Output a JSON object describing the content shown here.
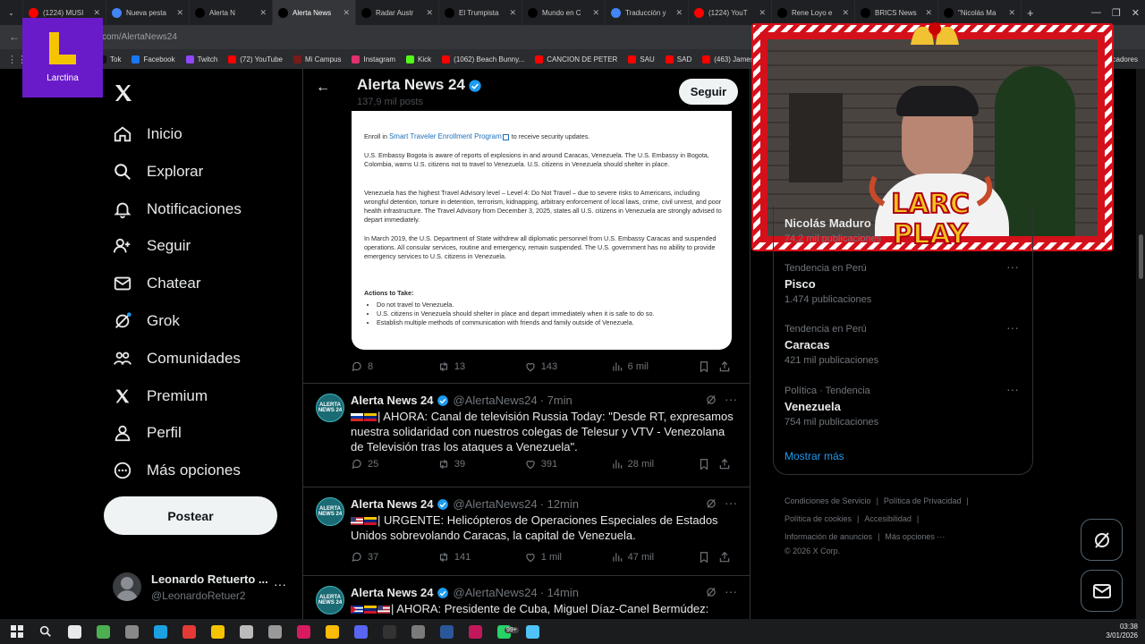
{
  "browser": {
    "tabs": [
      {
        "label": "(1224) MUSI",
        "color": "#ff0000"
      },
      {
        "label": "Nueva pesta",
        "color": "#4285f4"
      },
      {
        "label": "Alerta N",
        "color": "#000000"
      },
      {
        "label": "Alerta News",
        "color": "#000000",
        "active": true
      },
      {
        "label": "Radar Austr",
        "color": "#000000"
      },
      {
        "label": "El Trumpista",
        "color": "#000000"
      },
      {
        "label": "Mundo en C",
        "color": "#000000"
      },
      {
        "label": "Traducción y",
        "color": "#4285f4"
      },
      {
        "label": "(1224) YouT",
        "color": "#ff0000"
      },
      {
        "label": "Rene Loyo e",
        "color": "#000000"
      },
      {
        "label": "BRICS News",
        "color": "#000000"
      },
      {
        "label": "\"Nicolás Ma",
        "color": "#000000"
      }
    ],
    "new_tab": "+",
    "url": "com/AlertaNews24",
    "bookmarks": [
      {
        "label": "Tok",
        "color": "#111111"
      },
      {
        "label": "Facebook",
        "color": "#1877f2"
      },
      {
        "label": "Twitch",
        "color": "#9146ff"
      },
      {
        "label": "(72) YouTube",
        "color": "#ff0000"
      },
      {
        "label": "Mi Campus",
        "color": "#7b1a1a"
      },
      {
        "label": "Instagram",
        "color": "#e1306c"
      },
      {
        "label": "Kick",
        "color": "#53fc18"
      },
      {
        "label": "(1062) Beach Bunny...",
        "color": "#ff0000"
      },
      {
        "label": "CANCION DE PETER",
        "color": "#ff0000"
      },
      {
        "label": "SAU",
        "color": "#ff0000"
      },
      {
        "label": "SAD",
        "color": "#ff0000"
      },
      {
        "label": "(463) James Arth",
        "color": "#ff0000"
      }
    ],
    "bookmarks_end": "cadores"
  },
  "overlay": {
    "logo_label": "Larctina",
    "logo_letter": "L",
    "webcam_brand_line1": "LARC",
    "webcam_brand_line2": "PLAY"
  },
  "nav": {
    "items": [
      {
        "label": "Inicio",
        "icon": "home-icon"
      },
      {
        "label": "Explorar",
        "icon": "search-icon"
      },
      {
        "label": "Notificaciones",
        "icon": "bell-icon"
      },
      {
        "label": "Seguir",
        "icon": "follow-icon"
      },
      {
        "label": "Chatear",
        "icon": "mail-icon"
      },
      {
        "label": "Grok",
        "icon": "grok-icon"
      },
      {
        "label": "Comunidades",
        "icon": "communities-icon"
      },
      {
        "label": "Premium",
        "icon": "x-icon"
      },
      {
        "label": "Perfil",
        "icon": "person-icon"
      },
      {
        "label": "Más opciones",
        "icon": "more-icon"
      }
    ],
    "post_button": "Postear",
    "account_name": "Leonardo Retuerto ...",
    "account_handle": "@LeonardoRetuer2"
  },
  "header": {
    "title": "Alerta News 24",
    "posts_count": "137,9 mil posts",
    "follow_button": "Seguir"
  },
  "embedded_doc": {
    "enroll_pre": "Enroll in ",
    "enroll_link": "Smart Traveler Enrollment Program",
    "enroll_post": " to receive security updates.",
    "p1": "U.S. Embassy Bogota is aware of reports of explosions in and around Caracas, Venezuela. The U.S. Embassy in Bogota, Colombia, warns U.S. citizens not to travel to Venezuela.  U.S. citizens in Venezuela should shelter in place.",
    "p2": "Venezuela has the highest Travel Advisory level – Level 4: Do Not Travel – due to severe risks to Americans, including wrongful detention, torture in detention, terrorism, kidnapping, arbitrary enforcement of local laws, crime, civil unrest, and poor health infrastructure.  The Travel Advisory from December 3, 2025, states all U.S. citizens in Venezuela are strongly advised to depart immediately.",
    "p3": "In March 2019, the U.S. Department of State withdrew all diplomatic personnel from U.S. Embassy Caracas and suspended operations.  All consular services, routine and emergency, remain suspended.  The U.S. government has no ability to provide emergency services to U.S. citizens in Venezuela.",
    "actions_title": "Actions to Take:",
    "actions": [
      "Do not travel to Venezuela.",
      "U.S. citizens in Venezuela should shelter in place and depart immediately when it is safe to do so.",
      "Establish multiple methods of communication with friends and family outside of Venezuela."
    ],
    "stats": {
      "replies": "8",
      "reposts": "13",
      "likes": "143",
      "views": "6 mil"
    }
  },
  "tweets": [
    {
      "name": "Alerta News 24",
      "handle": "@AlertaNews24",
      "time": "· 7min",
      "flags": [
        "ru",
        "ve"
      ],
      "text": "| AHORA: Canal de televisión Russia Today: \"Desde RT, expresamos nuestra solidaridad con nuestros colegas de Telesur y VTV - Venezolana de Televisión tras los ataques a Venezuela\".",
      "replies": "25",
      "reposts": "39",
      "likes": "391",
      "views": "28 mil"
    },
    {
      "name": "Alerta News 24",
      "handle": "@AlertaNews24",
      "time": "· 12min",
      "flags": [
        "us",
        "ve"
      ],
      "text": "| URGENTE: Helicópteros de Operaciones Especiales de Estados Unidos sobrevolando Caracas, la capital de Venezuela.",
      "replies": "37",
      "reposts": "141",
      "likes": "1 mil",
      "views": "47 mil"
    },
    {
      "name": "Alerta News 24",
      "handle": "@AlertaNews24",
      "time": "· 14min",
      "flags": [
        "cu",
        "ve",
        "us"
      ],
      "text": "| AHORA: Presidente de Cuba, Miguel Díaz-Canel Bermúdez: \"Cuba",
      "replies": "",
      "reposts": "",
      "likes": "",
      "views": ""
    }
  ],
  "avatar_text": "ALERTA NEWS 24",
  "trends": [
    {
      "category": "",
      "name": "Nicolás Maduro",
      "posts": "74,2 mil publicaciones"
    },
    {
      "category": "Tendencia en Perú",
      "name": "Pisco",
      "posts": "1.474 publicaciones"
    },
    {
      "category": "Tendencia en Perú",
      "name": "Caracas",
      "posts": "421 mil publicaciones"
    },
    {
      "category": "Política · Tendencia",
      "name": "Venezuela",
      "posts": "754 mil publicaciones"
    }
  ],
  "show_more": "Mostrar más",
  "footer": {
    "links": [
      "Condiciones de Servicio",
      "Política de Privacidad",
      "Política de cookies",
      "Accesibilidad",
      "Información de anuncios",
      "Más opciones ···"
    ],
    "copyright": "© 2026 X Corp."
  },
  "system": {
    "time": "03:38",
    "date": "3/01/2026",
    "badge": "99+"
  },
  "colors": {
    "accent": "#1d9bf0",
    "logo_purple": "#6a1bc9",
    "logo_yellow": "#f5c400",
    "frame_red": "#d4101b"
  }
}
